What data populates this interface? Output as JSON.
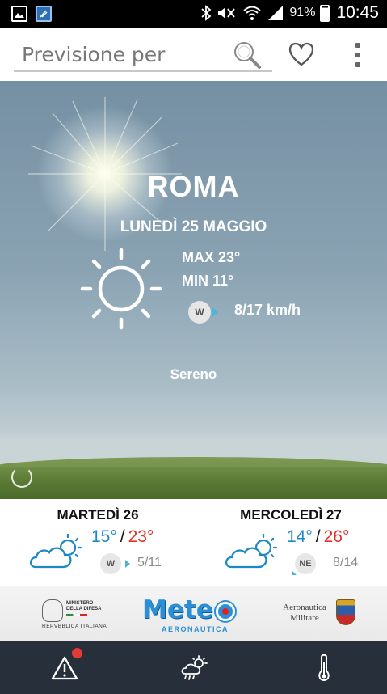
{
  "status_bar": {
    "battery": "91%",
    "time": "10:45",
    "icons": [
      "gallery-icon",
      "app-icon",
      "bluetooth-icon",
      "mute-icon",
      "wifi-icon",
      "signal-icon",
      "battery-icon"
    ]
  },
  "search": {
    "placeholder": "Previsione per",
    "search_icon": "search-icon",
    "favorite_icon": "heart-icon",
    "menu_icon": "more-vert-icon"
  },
  "current": {
    "city": "ROMA",
    "date": "LUNEDÌ 25 MAGGIO",
    "max": "MAX 23°",
    "min": "MIN 11°",
    "wind_dir": "W",
    "wind_speed": "8/17 km/h",
    "condition": "Sereno",
    "icon": "sun-icon"
  },
  "forecast": [
    {
      "day": "MARTEDÌ 26",
      "low": "15°",
      "sep": "/",
      "high": "23°",
      "wind_dir": "W",
      "wind_speed": "5/11",
      "icon": "partly-cloudy-icon"
    },
    {
      "day": "MERCOLEDÌ 27",
      "low": "14°",
      "sep": "/",
      "high": "26°",
      "wind_dir": "NE",
      "wind_speed": "8/14",
      "icon": "partly-cloudy-icon"
    }
  ],
  "logos": {
    "ministry_line1": "MINISTERO",
    "ministry_line2": "DELLA DIFESA",
    "ministry_bottom": "REPVBBLICA ITALIANA",
    "meteo": "Meteo",
    "meteo_sub": "AERONAUTICA",
    "am_line1": "Aeronautica",
    "am_line2": "Militare"
  },
  "bottom_nav": [
    {
      "name": "alerts",
      "icon": "warning-icon",
      "has_notification": true
    },
    {
      "name": "forecast",
      "icon": "cloud-sun-rain-icon"
    },
    {
      "name": "temperature",
      "icon": "thermometer-icon"
    }
  ],
  "colors": {
    "low_temp": "#1e88c7",
    "high_temp": "#e0312b",
    "nav_bg": "#27303a",
    "notification": "#e53935",
    "wind_arrow": "#4fb5d6"
  }
}
